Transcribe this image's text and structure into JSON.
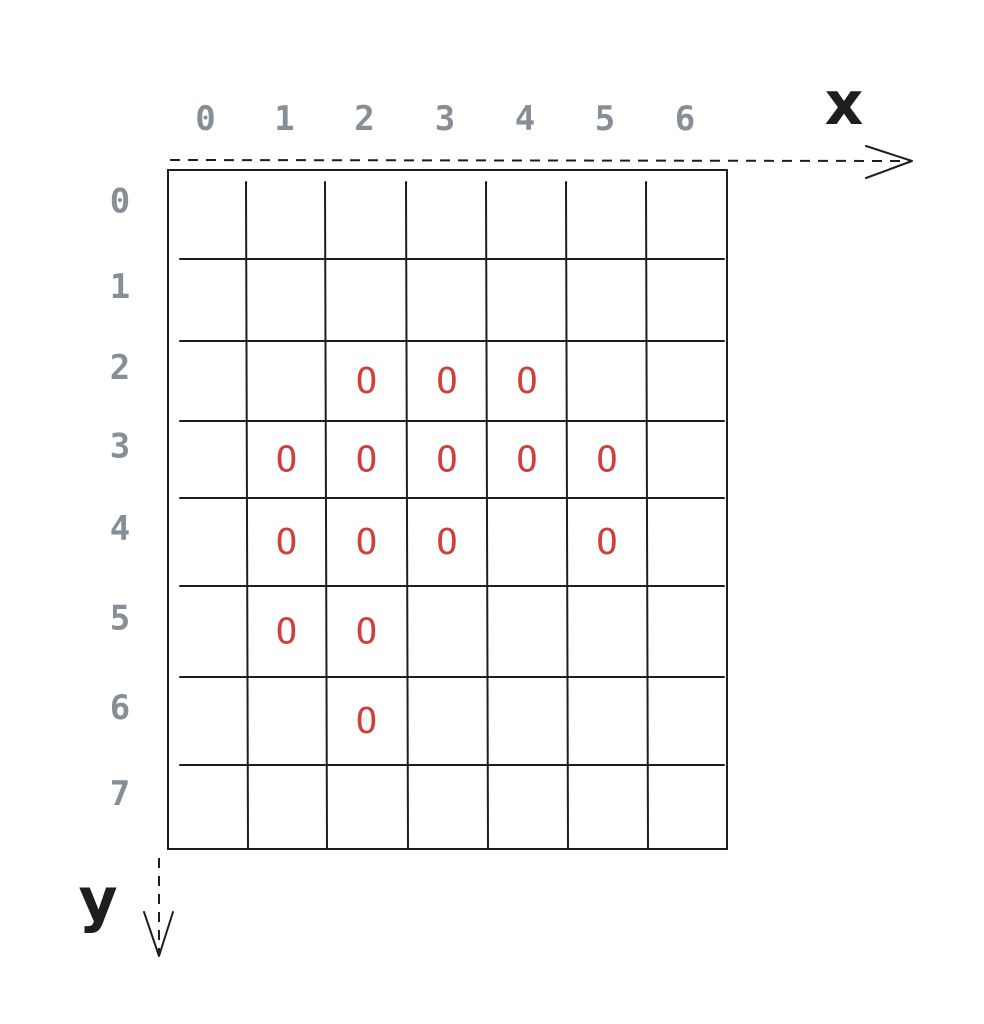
{
  "axes": {
    "x_label": "x",
    "y_label": "y",
    "x_ticks": [
      "0",
      "1",
      "2",
      "3",
      "4",
      "5",
      "6"
    ],
    "y_ticks": [
      "0",
      "1",
      "2",
      "3",
      "4",
      "5",
      "6",
      "7"
    ]
  },
  "grid": {
    "columns": 7,
    "rows": 8
  },
  "marks": {
    "symbol": "O",
    "cells": [
      {
        "x": 2,
        "y": 2
      },
      {
        "x": 3,
        "y": 2
      },
      {
        "x": 4,
        "y": 2
      },
      {
        "x": 1,
        "y": 3
      },
      {
        "x": 2,
        "y": 3
      },
      {
        "x": 3,
        "y": 3
      },
      {
        "x": 4,
        "y": 3
      },
      {
        "x": 5,
        "y": 3
      },
      {
        "x": 1,
        "y": 4
      },
      {
        "x": 2,
        "y": 4
      },
      {
        "x": 3,
        "y": 4
      },
      {
        "x": 5,
        "y": 4
      },
      {
        "x": 1,
        "y": 5
      },
      {
        "x": 2,
        "y": 5
      },
      {
        "x": 2,
        "y": 6
      }
    ]
  },
  "colors": {
    "mark": "#d0403b",
    "tick_label": "#868e96",
    "stroke": "#1e1e1e"
  }
}
